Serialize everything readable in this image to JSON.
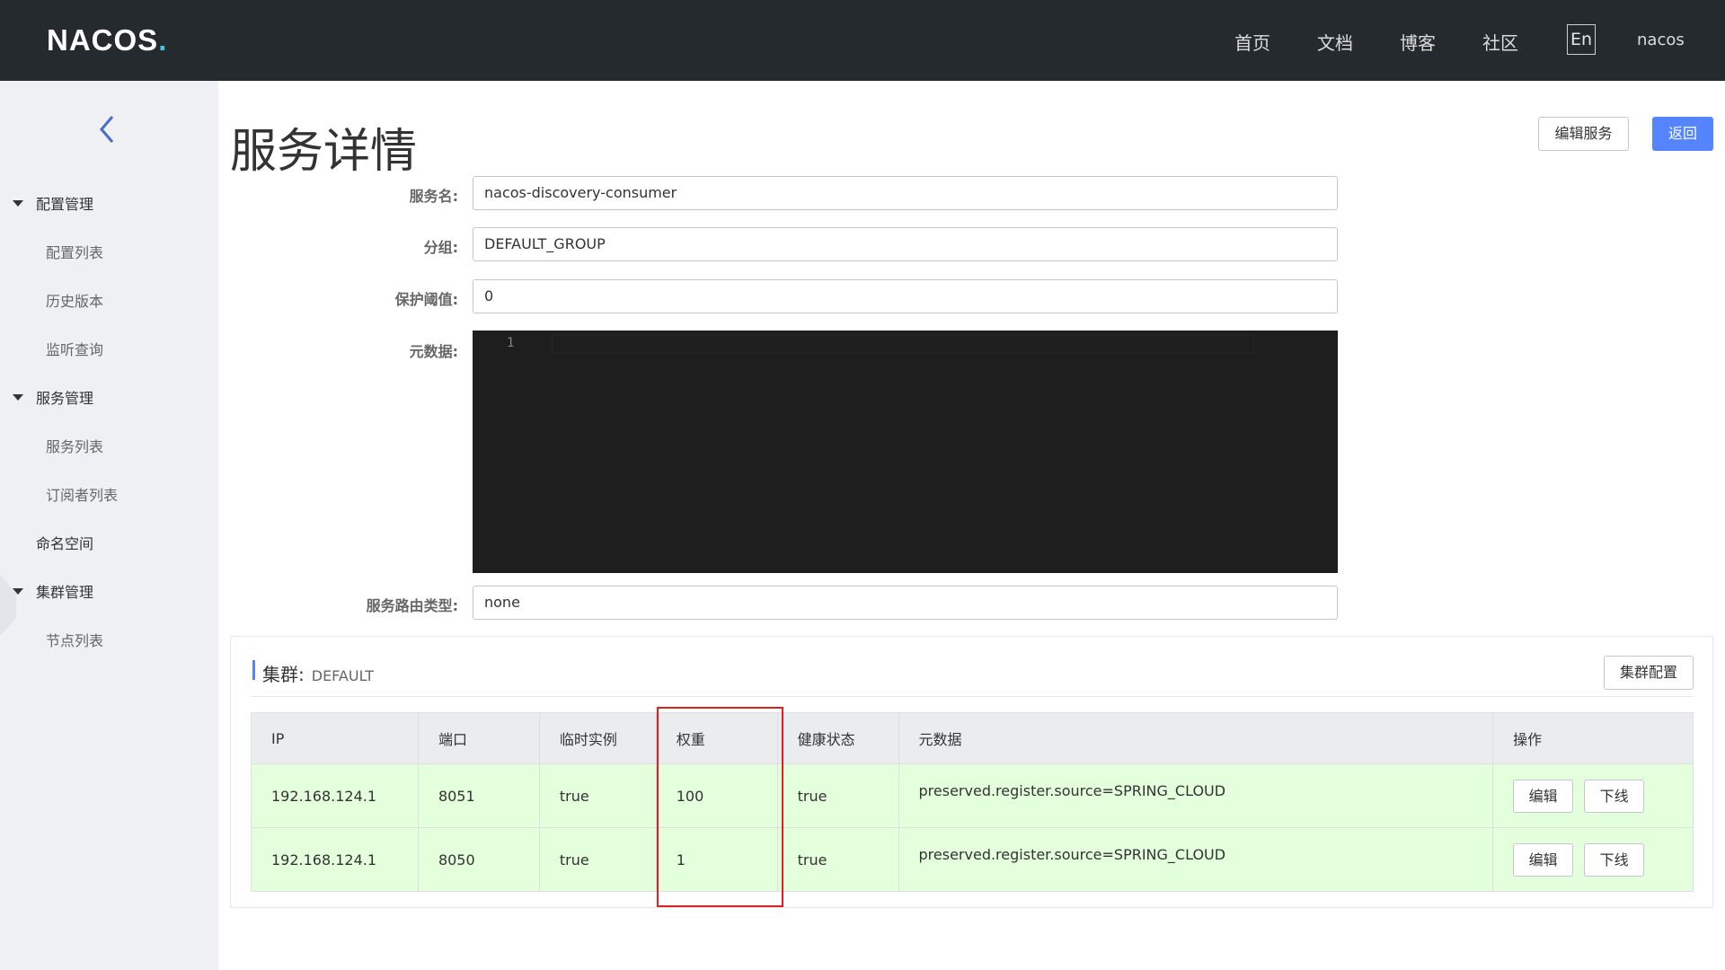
{
  "header": {
    "logo_text": "NACOS",
    "logo_dot": ".",
    "nav": [
      "首页",
      "文档",
      "博客",
      "社区"
    ],
    "lang_button": "En",
    "user": "nacos"
  },
  "sidebar": {
    "collapse_icon": "chevron-left-icon",
    "groups": [
      {
        "label": "配置管理",
        "items": [
          "配置列表",
          "历史版本",
          "监听查询"
        ]
      },
      {
        "label": "服务管理",
        "items": [
          "服务列表",
          "订阅者列表"
        ]
      }
    ],
    "namespace": "命名空间",
    "cluster_group": {
      "label": "集群管理",
      "items": [
        "节点列表"
      ]
    }
  },
  "page": {
    "title": "服务详情",
    "edit_button": "编辑服务",
    "back_button": "返回"
  },
  "form": {
    "service_name_label": "服务名:",
    "service_name": "nacos-discovery-consumer",
    "group_label": "分组:",
    "group": "DEFAULT_GROUP",
    "threshold_label": "保护阈值:",
    "threshold": "0",
    "metadata_label": "元数据:",
    "metadata_line_no": "1",
    "selector_label": "服务路由类型:",
    "selector": "none"
  },
  "cluster": {
    "label": "集群:",
    "name": "DEFAULT",
    "config_button": "集群配置",
    "columns": [
      "IP",
      "端口",
      "临时实例",
      "权重",
      "健康状态",
      "元数据",
      "操作"
    ],
    "rows": [
      {
        "ip": "192.168.124.1",
        "port": "8051",
        "ephemeral": "true",
        "weight": "100",
        "healthy": "true",
        "metadata": "preserved.register.source=SPRING_CLOUD",
        "edit": "编辑",
        "offline": "下线"
      },
      {
        "ip": "192.168.124.1",
        "port": "8050",
        "ephemeral": "true",
        "weight": "1",
        "healthy": "true",
        "metadata": "preserved.register.source=SPRING_CLOUD",
        "edit": "编辑",
        "offline": "下线"
      }
    ]
  },
  "colors": {
    "topbar": "#252a2f",
    "sidebar": "#eef0f3",
    "primary": "#5584ff",
    "healthy_row": "#e4ffdc",
    "highlight": "#e02020"
  }
}
